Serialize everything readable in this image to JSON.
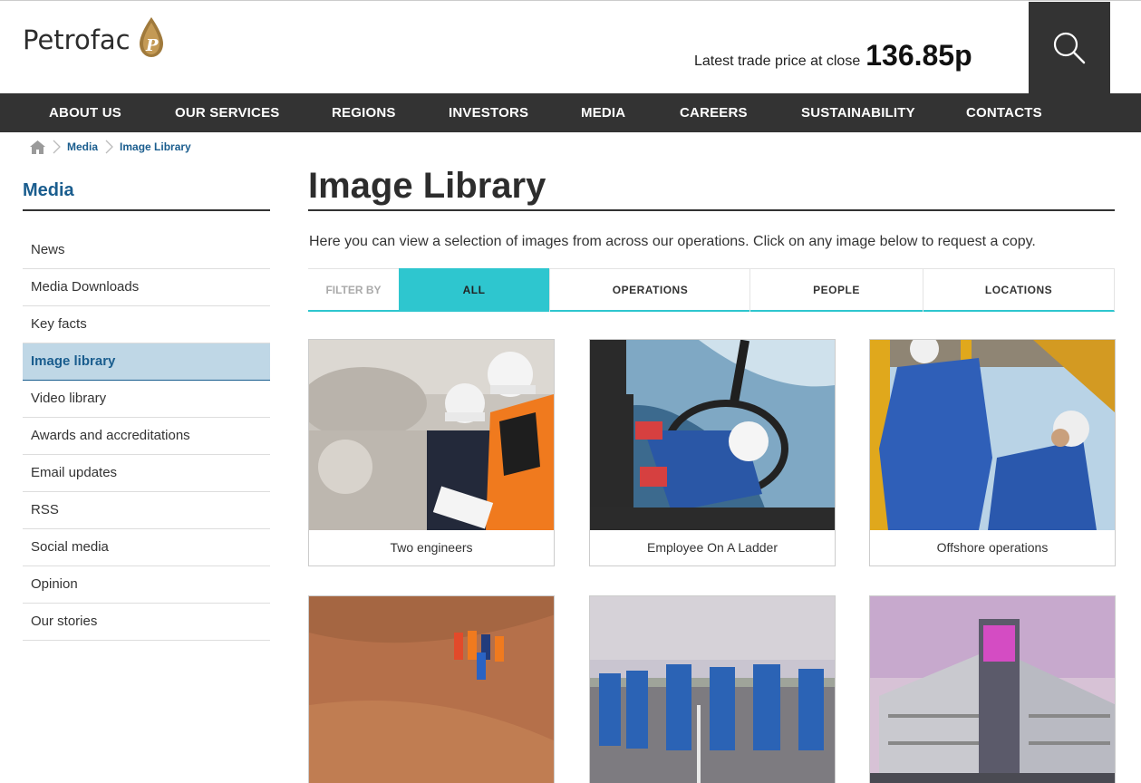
{
  "header": {
    "logo_text": "Petrofac",
    "trade_label": "Latest trade price at close",
    "trade_value": "136.85p",
    "search_icon": "search-icon"
  },
  "nav": {
    "items": [
      "ABOUT US",
      "OUR SERVICES",
      "REGIONS",
      "INVESTORS",
      "MEDIA",
      "CAREERS",
      "SUSTAINABILITY",
      "CONTACTS"
    ]
  },
  "breadcrumb": {
    "home_icon": "home-icon",
    "items": [
      "Media",
      "Image Library"
    ]
  },
  "sidebar": {
    "title": "Media",
    "items": [
      "News",
      "Media Downloads",
      "Key facts",
      "Image library",
      "Video library",
      "Awards and accreditations",
      "Email updates",
      "RSS",
      "Social media",
      "Opinion",
      "Our stories"
    ],
    "active": "Image library"
  },
  "main": {
    "title": "Image Library",
    "intro": "Here you can view a selection of images from across our operations. Click on any image below to request a copy.",
    "filter": {
      "label": "FILTER BY",
      "tabs": [
        "ALL",
        "OPERATIONS",
        "PEOPLE",
        "LOCATIONS"
      ],
      "active": "ALL"
    },
    "gallery": [
      {
        "caption": "Two engineers"
      },
      {
        "caption": "Employee On A Ladder"
      },
      {
        "caption": "Offshore operations"
      }
    ]
  },
  "colors": {
    "accent": "#2ec6cf",
    "brand_blue": "#1a5d8e",
    "nav_bg": "#333333",
    "active_side_bg": "#bfd7e6"
  }
}
